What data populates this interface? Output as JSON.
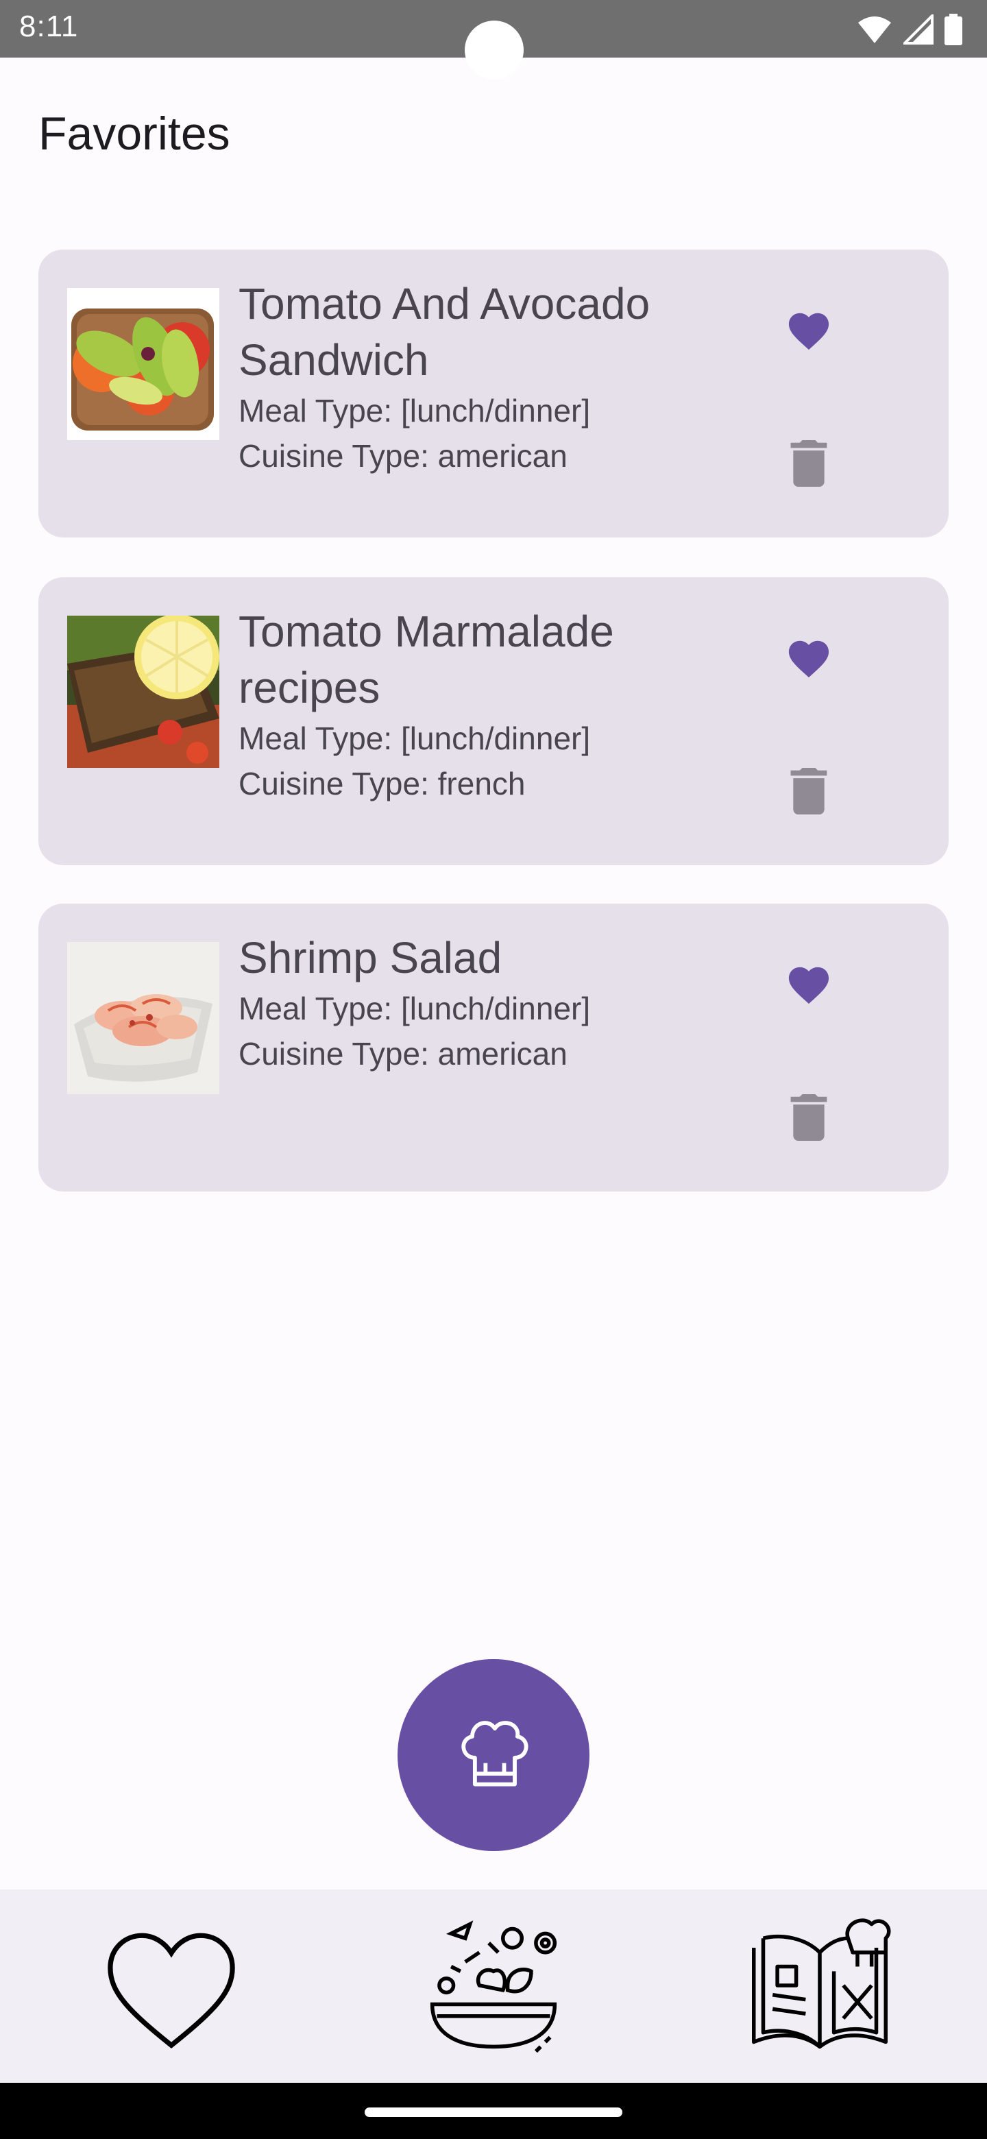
{
  "status": {
    "time": "8:11"
  },
  "page": {
    "title": "Favorites"
  },
  "recipes": [
    {
      "title": "Tomato And Avocado Sandwich",
      "meal_type": "Meal Type: [lunch/dinner]",
      "cuisine_type": "Cuisine Type: american",
      "image_icon": "avocado-toast-photo"
    },
    {
      "title": "Tomato Marmalade recipes",
      "meal_type": "Meal Type: [lunch/dinner]",
      "cuisine_type": "Cuisine Type: french",
      "image_icon": "fish-with-lemon-photo"
    },
    {
      "title": "Shrimp Salad",
      "meal_type": "Meal Type: [lunch/dinner]",
      "cuisine_type": "Cuisine Type: american",
      "image_icon": "shrimp-salad-photo"
    }
  ],
  "icons": {
    "favorite": "heart-filled-icon",
    "delete": "trash-icon",
    "fab": "chef-hat-icon",
    "nav": [
      "heart-outline-icon",
      "salad-bowl-icon",
      "recipe-book-icon"
    ]
  },
  "colors": {
    "accent": "#6750a4",
    "card_bg": "#e6e0eb",
    "nav_bg": "#f2eef5",
    "delete_icon": "#8f8a94"
  }
}
